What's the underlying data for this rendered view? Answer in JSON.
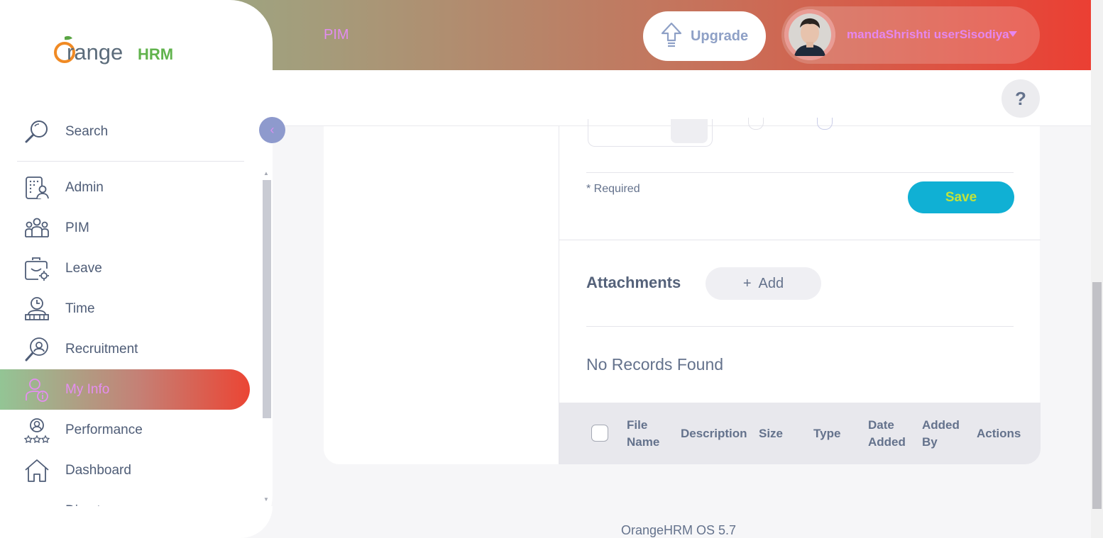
{
  "header": {
    "module": "PIM",
    "upgrade_label": "Upgrade",
    "user_name": "mandaShrishti userSisodiya",
    "help_label": "?"
  },
  "sidebar": {
    "logo_word": "range",
    "logo_suffix": "HRM",
    "search_label": "Search",
    "items": [
      {
        "label": "Admin",
        "icon": "admin-icon"
      },
      {
        "label": "PIM",
        "icon": "pim-icon"
      },
      {
        "label": "Leave",
        "icon": "leave-icon"
      },
      {
        "label": "Time",
        "icon": "time-icon"
      },
      {
        "label": "Recruitment",
        "icon": "recruitment-icon"
      },
      {
        "label": "My Info",
        "icon": "my-info-icon",
        "active": true
      },
      {
        "label": "Performance",
        "icon": "performance-icon"
      },
      {
        "label": "Dashboard",
        "icon": "dashboard-icon"
      },
      {
        "label": "Directory",
        "icon": "directory-icon"
      }
    ]
  },
  "form": {
    "required_note": "* Required",
    "save_label": "Save"
  },
  "attachments": {
    "title": "Attachments",
    "add_label": "Add",
    "add_symbol": "+",
    "empty_message": "No Records Found",
    "columns": [
      [
        "File",
        "Name"
      ],
      [
        "Description"
      ],
      [
        "Size"
      ],
      [
        "Type"
      ],
      [
        "Date",
        "Added"
      ],
      [
        "Added",
        "By"
      ],
      [
        "Actions"
      ]
    ]
  },
  "footer": {
    "version": "OrangeHRM OS 5.7"
  },
  "colors": {
    "accent_teal": "#10b0d4",
    "save_text": "#c2e33b",
    "gradient_start": "#8fb98f",
    "gradient_end": "#eb3f33"
  }
}
